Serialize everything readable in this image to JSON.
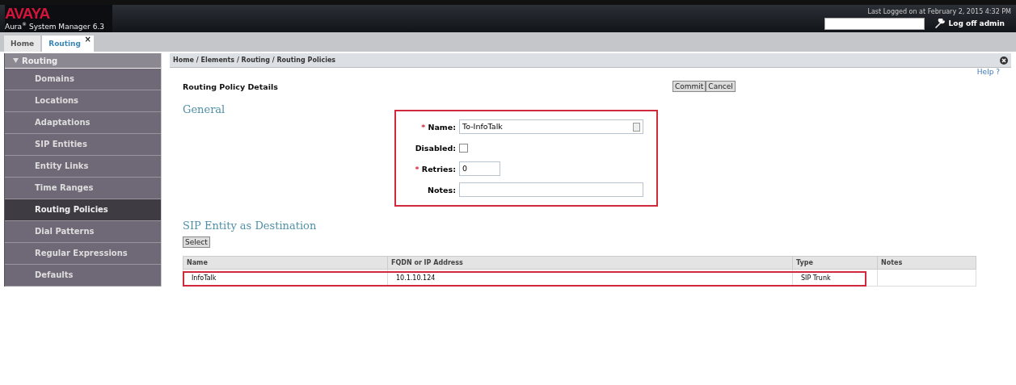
{
  "header": {
    "logo": "AVAYA",
    "product": "Aura",
    "product_mark": "®",
    "product_rest": " System Manager 6.3",
    "last_login": "Last Logged on at February 2, 2015 4:32 PM",
    "logoff": "Log off admin"
  },
  "tabs": [
    {
      "label": "Home",
      "selected": false
    },
    {
      "label": "Routing",
      "selected": true,
      "close": "×"
    }
  ],
  "sidebar": {
    "title": "Routing",
    "expanded": true,
    "items": [
      {
        "label": "Domains",
        "selected": false
      },
      {
        "label": "Locations",
        "selected": false
      },
      {
        "label": "Adaptations",
        "selected": false
      },
      {
        "label": "SIP Entities",
        "selected": false
      },
      {
        "label": "Entity Links",
        "selected": false
      },
      {
        "label": "Time Ranges",
        "selected": false
      },
      {
        "label": "Routing Policies",
        "selected": true
      },
      {
        "label": "Dial Patterns",
        "selected": false
      },
      {
        "label": "Regular Expressions",
        "selected": false
      },
      {
        "label": "Defaults",
        "selected": false
      }
    ]
  },
  "breadcrumb": "Home / Elements / Routing / Routing Policies",
  "help": "Help ?",
  "page_title": "Routing Policy Details",
  "buttons": [
    "Commit",
    "Cancel"
  ],
  "general": {
    "heading": "General",
    "fields": [
      {
        "kind": "text",
        "label": "Name:",
        "required_mark": "*",
        "value": "To-InfoTalk"
      },
      {
        "kind": "checkbox",
        "label": "Disabled:",
        "checked": false
      },
      {
        "kind": "short",
        "label": "Retries:",
        "required_mark": "*",
        "value": "0"
      },
      {
        "kind": "text",
        "label": "Notes:"
      }
    ]
  },
  "destination": {
    "heading": "SIP Entity as Destination",
    "select": "Select",
    "columns": [
      "Name",
      "FQDN or IP Address",
      "Type",
      "Notes"
    ],
    "rows": [
      [
        "InfoTalk",
        "10.1.10.124",
        "SIP Trunk",
        ""
      ]
    ]
  }
}
